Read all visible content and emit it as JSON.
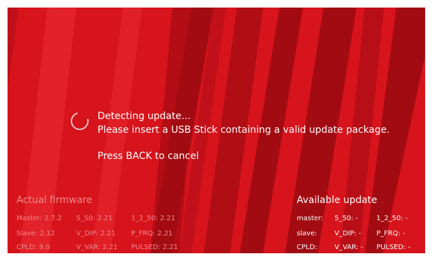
{
  "status": {
    "line1": "Detecting update...",
    "line2": "Please insert a USB Stick containing a valid update package.",
    "cancel_hint": "Press BACK to cancel"
  },
  "actual_firmware": {
    "title": "Actual firmware",
    "rows": [
      [
        "Master: 2.7.2",
        "5_50: 2.21",
        "1_2_50: 2.21"
      ],
      [
        "Slave: 2.12",
        "V_DIP: 2.21",
        "P_FRQ: 2.21"
      ],
      [
        "CPLD: 9.0",
        "V_VAR: 2.21",
        "PULSED: 2.21"
      ]
    ]
  },
  "available_update": {
    "title": "Available update",
    "rows": [
      [
        "master:",
        "5_50: -",
        "1_2_50: -"
      ],
      [
        "slave:",
        "V_DIP: -",
        "P_FRQ: -"
      ],
      [
        "CPLD:",
        "V_VAR: -",
        "PULSED: -"
      ]
    ]
  },
  "colors": {
    "background": "#d7131c",
    "stripe_dark": "#a30b12",
    "stripe_light": "#e22128",
    "text_primary": "#ffffff",
    "text_dim": "#f08b8e"
  },
  "icons": {
    "spinner": "loading-spinner-icon"
  }
}
